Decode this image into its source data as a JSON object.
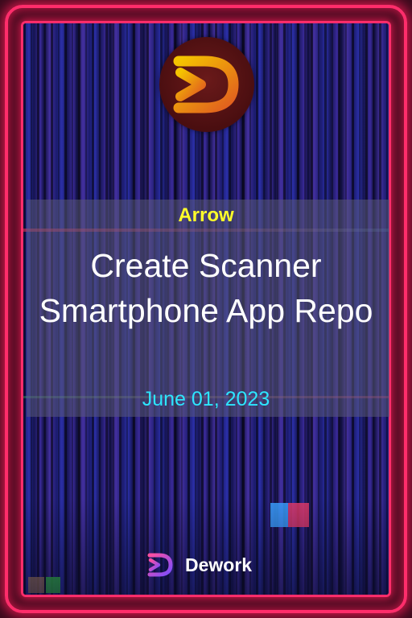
{
  "card": {
    "org_name": "Arrow",
    "title": "Create Scanner Smartphone App Repo",
    "date": "June 01, 2023"
  },
  "logo": {
    "icon": "dework-logo-icon",
    "colors": {
      "circle": "#4a0e10",
      "gradient_start": "#f5c400",
      "gradient_end": "#e05a20"
    }
  },
  "brand": {
    "icon": "dework-logo-icon",
    "name": "Dework",
    "colors": {
      "gradient_start": "#ff4fa0",
      "gradient_end": "#7a4dff"
    }
  },
  "colors": {
    "frame": "#ff2d6b",
    "org_text": "#ffff2a",
    "title_text": "#ffffff",
    "date_text": "#2de6ff"
  }
}
